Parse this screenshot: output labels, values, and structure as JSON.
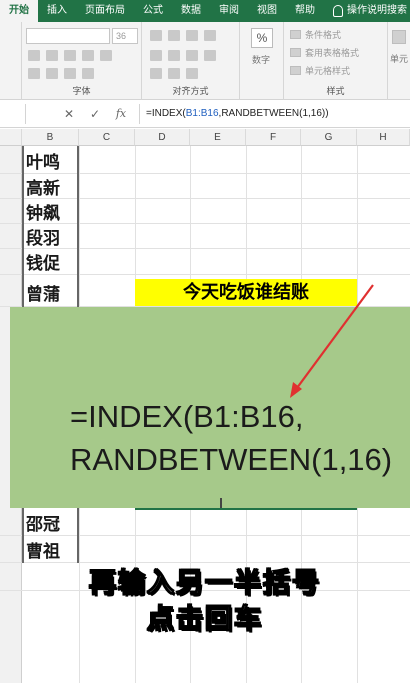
{
  "ribbon": {
    "tabs": [
      "开始",
      "插入",
      "页面布局",
      "公式",
      "数据",
      "审阅",
      "视图",
      "帮助"
    ],
    "search_label": "操作说明搜索",
    "font_size": "36",
    "groups": {
      "font": "字体",
      "alignment": "对齐方式",
      "number": "数字",
      "styles": "样式"
    },
    "number_symbol": "%",
    "styles_items": [
      "条件格式",
      "套用表格格式",
      "单元格样式"
    ],
    "cells_label": "单元"
  },
  "formula_bar": {
    "name_box": "",
    "cancel": "✕",
    "enter": "✓",
    "fx": "fx",
    "formula_prefix": "=INDEX(",
    "formula_range": "B1:B16",
    "formula_suffix": ",RANDBETWEEN(1,16))"
  },
  "columns": [
    "B",
    "C",
    "D",
    "E",
    "F",
    "G",
    "H"
  ],
  "names": [
    "叶鸣",
    "高新",
    "钟飙",
    "段羽",
    "钱促",
    "曾蒲",
    "邵冠",
    "曹祖"
  ],
  "yellow_cell": "今天吃饭谁结账",
  "overlay": {
    "line1": "=INDEX(B1:B16,",
    "line2": "RANDBETWEEN(1,16)"
  },
  "caption": {
    "line1": "再输入另一半括号",
    "line2": "点击回车"
  },
  "colors": {
    "excel_green": "#217346",
    "highlight_yellow": "#ffff00",
    "overlay_green": "#a6c98a",
    "arrow_red": "#e03030"
  }
}
